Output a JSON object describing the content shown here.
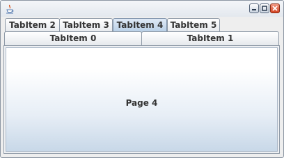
{
  "window": {
    "icon": "java-cup-icon",
    "controls": {
      "minimize_icon": "minimize-icon",
      "maximize_icon": "maximize-icon",
      "close_icon": "close-icon"
    }
  },
  "tabs": {
    "back_row": [
      {
        "label": "TabItem 2",
        "selected": false
      },
      {
        "label": "TabItem 3",
        "selected": false
      },
      {
        "label": "TabItem 4",
        "selected": true
      },
      {
        "label": "TabItem 5",
        "selected": false
      }
    ],
    "front_row": [
      {
        "label": "TabItem 0",
        "selected": false
      },
      {
        "label": "TabItem 1",
        "selected": false
      }
    ]
  },
  "page": {
    "label": "Page 4"
  },
  "colors": {
    "selected_tab": "#b8cfe6",
    "close_button": "#d44322"
  }
}
